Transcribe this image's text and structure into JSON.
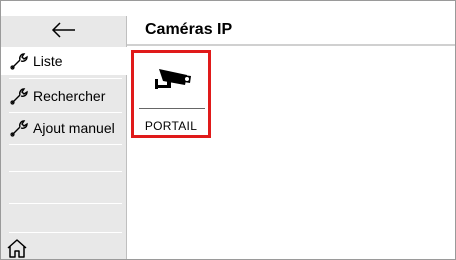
{
  "header": {
    "title": "Caméras IP"
  },
  "sidebar": {
    "items": [
      {
        "label": "Liste",
        "icon": "wrench-icon",
        "active": true
      },
      {
        "label": "Rechercher",
        "icon": "wrench-icon",
        "active": false
      },
      {
        "label": "Ajout manuel",
        "icon": "wrench-icon",
        "active": false
      }
    ],
    "back_icon": "arrow-left-icon",
    "home_icon": "home-icon"
  },
  "cameras": [
    {
      "label": "PORTAIL",
      "icon": "security-camera-icon",
      "selected": true
    }
  ],
  "colors": {
    "selection_border": "#e01a1a",
    "sidebar_bg": "#e8e8e8"
  }
}
